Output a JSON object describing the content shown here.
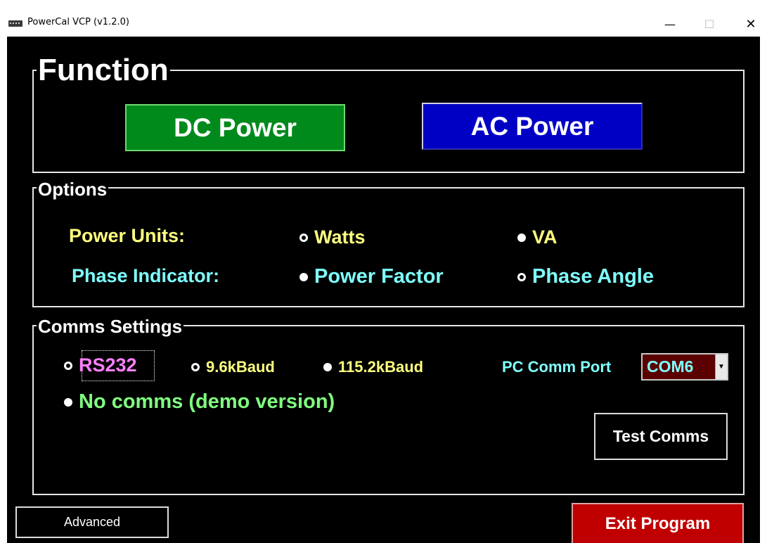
{
  "window": {
    "title": "PowerCal VCP  (v1.2.0)",
    "app_icon": "app-icon",
    "controls": {
      "minimize": "—",
      "maximize": "☐",
      "close": "✕"
    }
  },
  "function_group": {
    "legend": "Function",
    "dc_power_label": "DC Power",
    "ac_power_label": "AC Power",
    "colors": {
      "dc": "#008a1c",
      "ac": "#0000c4"
    }
  },
  "options_group": {
    "legend": "Options",
    "power_units": {
      "label": "Power Units:",
      "options": [
        {
          "label": "Watts",
          "checked": true
        },
        {
          "label": "VA",
          "checked": false
        }
      ]
    },
    "phase_indicator": {
      "label": "Phase Indicator:",
      "options": [
        {
          "label": "Power Factor",
          "checked": false
        },
        {
          "label": "Phase Angle",
          "checked": true
        }
      ]
    }
  },
  "comms_group": {
    "legend": "Comms Settings",
    "rs232": {
      "label": "RS232",
      "checked": true
    },
    "baud_options": [
      {
        "label": "9.6kBaud",
        "checked": true
      },
      {
        "label": "115.2kBaud",
        "checked": false
      }
    ],
    "no_comms": {
      "label": "No comms (demo version)",
      "checked": false
    },
    "port_label": "PC Comm Port",
    "port_value": "COM6",
    "test_button": "Test Comms"
  },
  "footer": {
    "advanced_button": "Advanced",
    "exit_button": "Exit Program"
  }
}
